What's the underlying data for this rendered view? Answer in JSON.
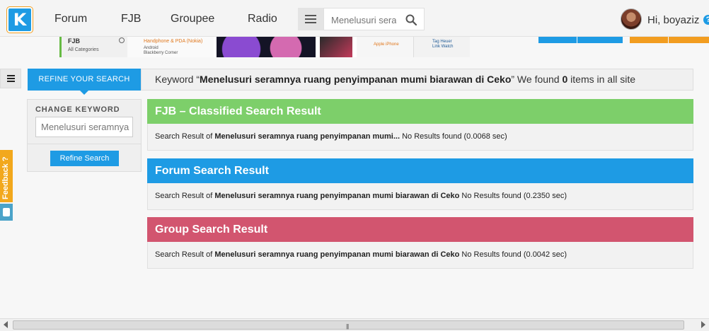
{
  "nav": {
    "logo_letter": "K",
    "links": [
      "Forum",
      "FJB",
      "Groupee",
      "Radio"
    ],
    "search_placeholder": "Menelusuri seramnya",
    "greeting": "Hi, boyaziz",
    "help_glyph": "?"
  },
  "banner": {
    "fjb_title": "FJB",
    "fjb_sub": "All Categories",
    "phone_title": "Handphone & PDA (Nokia)",
    "phone_line2": "Android",
    "phone_line3": "Blackberry Corner",
    "apple_label": "Apple iPhone",
    "tag_line1": "Tag Heuer",
    "tag_line2": "Link Watch"
  },
  "refine": {
    "tab_label": "REFINE YOUR SEARCH",
    "change_keyword_label": "CHANGE KEYWORD",
    "keyword_value": "Menelusuri seramnya",
    "button_label": "Refine Search"
  },
  "summary": {
    "prefix": "Keyword “",
    "keyword": "Menelusuri seramnya ruang penyimpanan mumi biarawan di Ceko",
    "mid": "” We found ",
    "count": "0",
    "suffix": " items in all site"
  },
  "results": [
    {
      "title": "FJB – Classified Search Result",
      "prefix": "Search Result of ",
      "query": "Menelusuri seramnya ruang penyimpanan mumi...",
      "status": " No Results found (0.0068 sec)",
      "color": "#7dcf6a"
    },
    {
      "title": "Forum Search Result",
      "prefix": "Search Result of ",
      "query": "Menelusuri seramnya ruang penyimpanan mumi biarawan di Ceko",
      "status": " No Results found (0.2350 sec)",
      "color": "#1e9be4"
    },
    {
      "title": "Group Search Result",
      "prefix": "Search Result of ",
      "query": "Menelusuri seramnya ruang penyimpanan mumi biarawan di Ceko",
      "status": " No Results found (0.0042 sec)",
      "color": "#d2556f"
    }
  ],
  "feedback_label": "Feedback ?",
  "scrollbar_grip": "|||",
  "colors": {
    "brand_blue": "#1e9be4",
    "orange": "#f29d20",
    "green": "#7dcf6a",
    "pink": "#d2556f"
  }
}
